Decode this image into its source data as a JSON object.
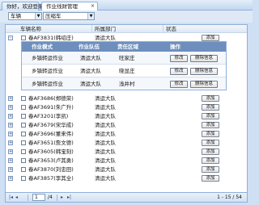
{
  "tabs": [
    {
      "label": "你好，欢迎登录"
    },
    {
      "label": "作业线财管理",
      "close": "×"
    }
  ],
  "filters": {
    "field": "车辆",
    "value": "压缩车",
    "arrow": "▼"
  },
  "grid": {
    "columns": [
      "车辆名称",
      "所属部门",
      "状态"
    ],
    "rows": [
      {
        "toggle": "-",
        "plate": "春AF3831(韩绍庄)",
        "dept": "清运大队",
        "status": "",
        "add": "添加",
        "expanded": true
      },
      {
        "toggle": "+",
        "plate": "春AF3686(郑德荣)",
        "dept": "清运大队",
        "status": "",
        "add": "添加"
      },
      {
        "toggle": "+",
        "plate": "春AF3691(朱广升)",
        "dept": "清运大队",
        "status": "",
        "add": "添加"
      },
      {
        "toggle": "+",
        "plate": "春AF3201(李凯)",
        "dept": "清运大队",
        "status": "",
        "add": "添加"
      },
      {
        "toggle": "+",
        "plate": "春AF3679(宋华成)",
        "dept": "清运大队",
        "status": "",
        "add": "添加"
      },
      {
        "toggle": "+",
        "plate": "春AF3696(董来伟)",
        "dept": "清运大队",
        "status": "",
        "add": "添加"
      },
      {
        "toggle": "+",
        "plate": "春AF3651(詹文德)",
        "dept": "清运大队",
        "status": "",
        "add": "添加"
      },
      {
        "toggle": "+",
        "plate": "春AF3605(韩宝刻)",
        "dept": "清运大队",
        "status": "",
        "add": "添加"
      },
      {
        "toggle": "+",
        "plate": "春AF3653(卢其勇)",
        "dept": "清运大队",
        "status": "",
        "add": "添加"
      },
      {
        "toggle": "+",
        "plate": "春AF3870(刘忠田)",
        "dept": "清运大队",
        "status": "",
        "add": "添加"
      },
      {
        "toggle": "+",
        "plate": "春AF3857(李其全)",
        "dept": "清运大队",
        "status": "",
        "add": "添加"
      }
    ],
    "subtable": {
      "columns": [
        "作业模式",
        "作业队伍",
        "责任区域",
        "操作"
      ],
      "rows": [
        {
          "mode": "乡镇转运作业",
          "team": "清运大队",
          "area": "旺家庄",
          "edit": "修改",
          "delete": "删除信息"
        },
        {
          "mode": "乡镇转运作业",
          "team": "清运大队",
          "area": "晓显庄",
          "edit": "修改",
          "delete": "删除信息"
        },
        {
          "mode": "乡镇转运作业",
          "team": "清运大队",
          "area": "浅井村",
          "edit": "修改",
          "delete": "删除信息"
        }
      ]
    }
  },
  "pager": {
    "first": "|◂",
    "prev": "◂",
    "page": "1",
    "total": "/4",
    "next": "▸",
    "last": "▸|",
    "range": "1 - 15 / 54"
  }
}
